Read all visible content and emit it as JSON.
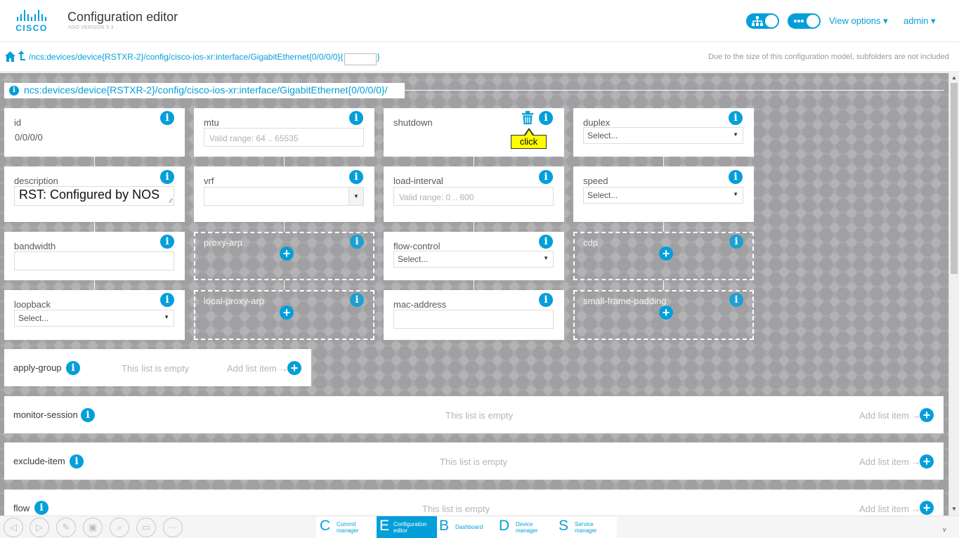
{
  "header": {
    "logo_text": "CISCO",
    "title": "Configuration editor",
    "version": "NSO VERSION 5.3",
    "view_options": "View options ▾",
    "user": "admin ▾",
    "toggle_icons": [
      "topology-icon",
      "more-icon"
    ]
  },
  "pathbar": {
    "path": "/ncs:devices/device{RSTXR-2}/config/cisco-ios-xr:interface/GigabitEthernet{0/0/0/0}{",
    "path_end": "}",
    "key_value": "",
    "note": "Due to the size of this configuration model, subfolders are not included"
  },
  "breadcrumb": "ncs:devices/device{RSTXR-2}/config/cisco-ios-xr:interface/GigabitEthernet{0/0/0/0}/",
  "leaves": {
    "id": {
      "label": "id",
      "value": "0/0/0/0"
    },
    "mtu": {
      "label": "mtu",
      "placeholder": "Valid range: 64 .. 65535"
    },
    "shutdown": {
      "label": "shutdown",
      "tooltip": "click"
    },
    "duplex": {
      "label": "duplex",
      "value": "Select..."
    },
    "description": {
      "label": "description",
      "value": "RST: Configured by NOS"
    },
    "vrf": {
      "label": "vrf",
      "value": ""
    },
    "load_interval": {
      "label": "load-interval",
      "placeholder": "Valid range: 0 .. 600"
    },
    "speed": {
      "label": "speed",
      "value": "Select..."
    },
    "bandwidth": {
      "label": "bandwidth",
      "value": ""
    },
    "proxy_arp": {
      "label": "proxy-arp"
    },
    "flow_control": {
      "label": "flow-control",
      "value": "Select..."
    },
    "cdp": {
      "label": "cdp"
    },
    "loopback": {
      "label": "loopback",
      "value": "Select..."
    },
    "local_proxy_arp": {
      "label": "local-proxy-arp"
    },
    "mac_address": {
      "label": "mac-address",
      "value": ""
    },
    "small_frame_padding": {
      "label": "small-frame-padding"
    }
  },
  "lists": [
    {
      "name": "apply-group",
      "empty_text": "This list is empty",
      "add_text": "Add list item →"
    },
    {
      "name": "monitor-session",
      "empty_text": "This list is empty",
      "add_text": "Add list item →"
    },
    {
      "name": "exclude-item",
      "empty_text": "This list is empty",
      "add_text": "Add list item →"
    },
    {
      "name": "flow",
      "empty_text": "This list is empty",
      "add_text": "Add list item →"
    }
  ],
  "bottom_nav": [
    {
      "letter": "C",
      "line1": "Commit",
      "line2": "manager",
      "active": false
    },
    {
      "letter": "E",
      "line1": "Configuration",
      "line2": "editor",
      "active": true
    },
    {
      "letter": "B",
      "line1": "Dashboard",
      "line2": "",
      "active": false
    },
    {
      "letter": "D",
      "line1": "Device",
      "line2": "manager",
      "active": false
    },
    {
      "letter": "S",
      "line1": "Service",
      "line2": "manager",
      "active": false
    }
  ],
  "bottom_tools": [
    "back-icon",
    "forward-icon",
    "edit-icon",
    "compare-icon",
    "search-icon",
    "terminal-icon",
    "more-icon"
  ],
  "colors": {
    "accent": "#049fd9",
    "background": "#a9a9ab",
    "tooltip": "#ffff00"
  }
}
